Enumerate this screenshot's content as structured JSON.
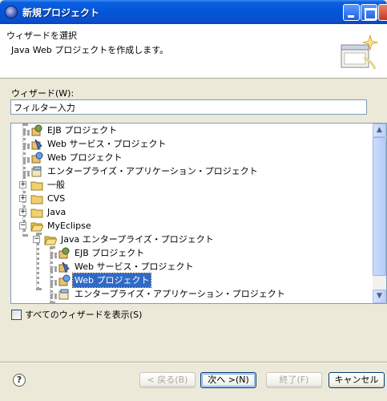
{
  "window": {
    "title": "新規プロジェクト"
  },
  "header": {
    "title": "ウィザードを選択",
    "description": "Java Web プロジェクトを作成します。"
  },
  "wizard_label": "ウィザード(W):",
  "filter": {
    "value": "フィルター入力"
  },
  "tree": {
    "items": [
      {
        "label": "EJB プロジェクト",
        "icon": "ejb-project-icon"
      },
      {
        "label": "Web サービス・プロジェクト",
        "icon": "web-service-project-icon"
      },
      {
        "label": "Web プロジェクト",
        "icon": "web-project-icon"
      },
      {
        "label": "エンタープライズ・アプリケーション・プロジェクト",
        "icon": "enterprise-app-project-icon"
      },
      {
        "label": "一般",
        "icon": "folder-icon"
      },
      {
        "label": "CVS",
        "icon": "folder-icon"
      },
      {
        "label": "Java",
        "icon": "folder-icon"
      },
      {
        "label": "MyEclipse",
        "icon": "folder-open-icon"
      },
      {
        "label": "Java エンタープライズ・プロジェクト",
        "icon": "folder-open-icon"
      },
      {
        "label": "EJB プロジェクト",
        "icon": "ejb-project-icon"
      },
      {
        "label": "Web サービス・プロジェクト",
        "icon": "web-service-project-icon"
      },
      {
        "label": "Web プロジェクト",
        "icon": "web-project-icon",
        "selected": true
      },
      {
        "label": "エンタープライズ・アプリケーション・プロジェクト",
        "icon": "enterprise-app-project-icon"
      }
    ]
  },
  "show_all": {
    "label": "すべてのウィザードを表示(S)",
    "checked": false
  },
  "buttons": {
    "back": "< 戻る(B)",
    "next": "次へ >(N)",
    "finish": "終了(F)",
    "cancel": "キャンセル"
  },
  "help": "?"
}
